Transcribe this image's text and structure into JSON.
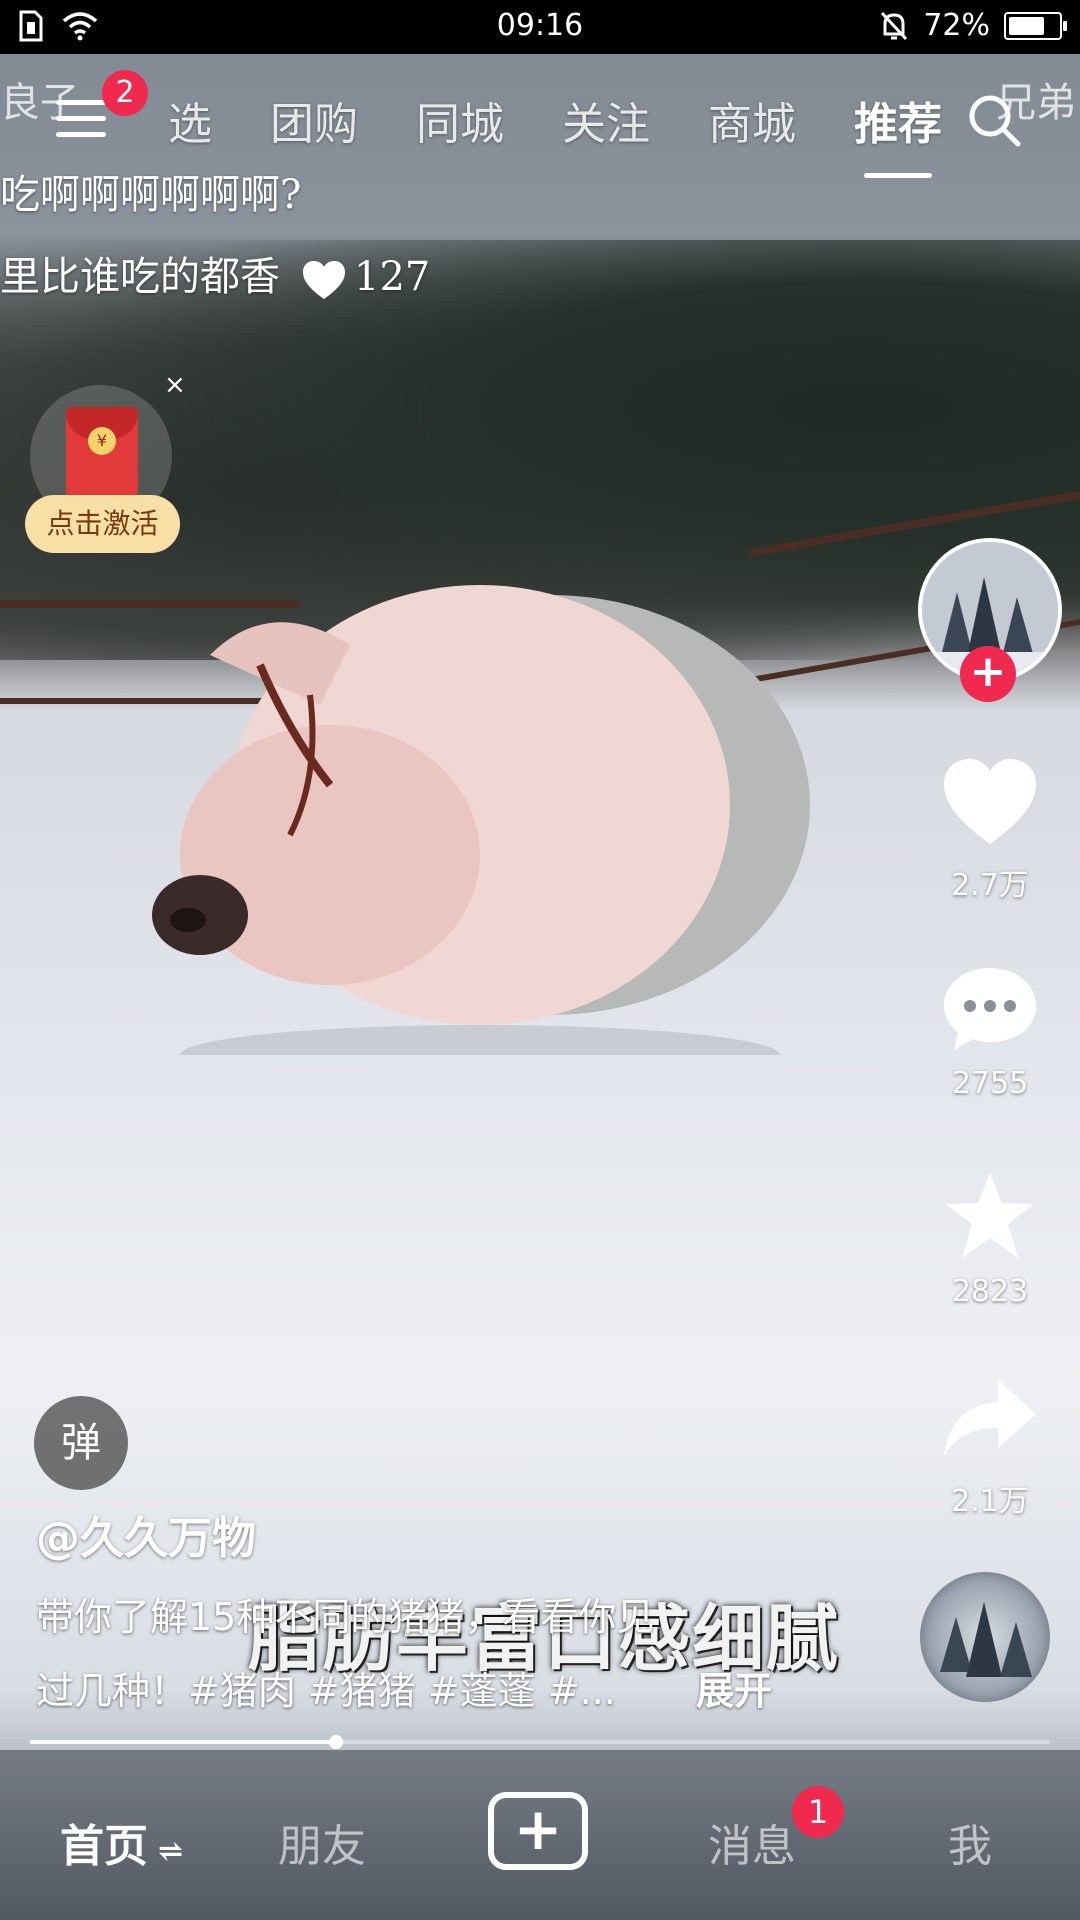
{
  "status_bar": {
    "time": "09:16",
    "battery": "72%",
    "battery_level": 0.72
  },
  "top_nav": {
    "menu_badge": "2",
    "tabs": [
      {
        "label": "选",
        "active": false
      },
      {
        "label": "团购",
        "active": false
      },
      {
        "label": "同城",
        "active": false
      },
      {
        "label": "关注",
        "active": false
      },
      {
        "label": "商城",
        "active": false
      },
      {
        "label": "推荐",
        "active": true
      }
    ],
    "ghost_left": "良子",
    "ghost_right": "兄弟"
  },
  "overlay_comments": {
    "line1": "吃啊啊啊啊啊啊?",
    "line2": "里比谁吃的都香",
    "likes": "127"
  },
  "red_packet": {
    "close": "×",
    "coin": "¥",
    "button": "点击激活"
  },
  "right_rail": {
    "follow_plus": "+",
    "likes": "2.7万",
    "comments": "2755",
    "favorites": "2823",
    "shares": "2.1万"
  },
  "video": {
    "subtitle": "脂肪丰富口感细腻",
    "danmu_button": "弹",
    "author": "@久久万物",
    "description_line1": "带你了解15种不同的猪猪，看看你见",
    "description_line2": "过几种！#猪肉 #猪猪 #蓬蓬 #...",
    "expand": "展开",
    "progress": 0.3
  },
  "bottom_nav": {
    "home": "首页",
    "home_refresh": "⇌",
    "friends": "朋友",
    "create": "+",
    "messages": "消息",
    "messages_badge": "1",
    "me": "我"
  },
  "colors": {
    "accent": "#f0294f",
    "activate_bg": "#f7dfa6"
  }
}
